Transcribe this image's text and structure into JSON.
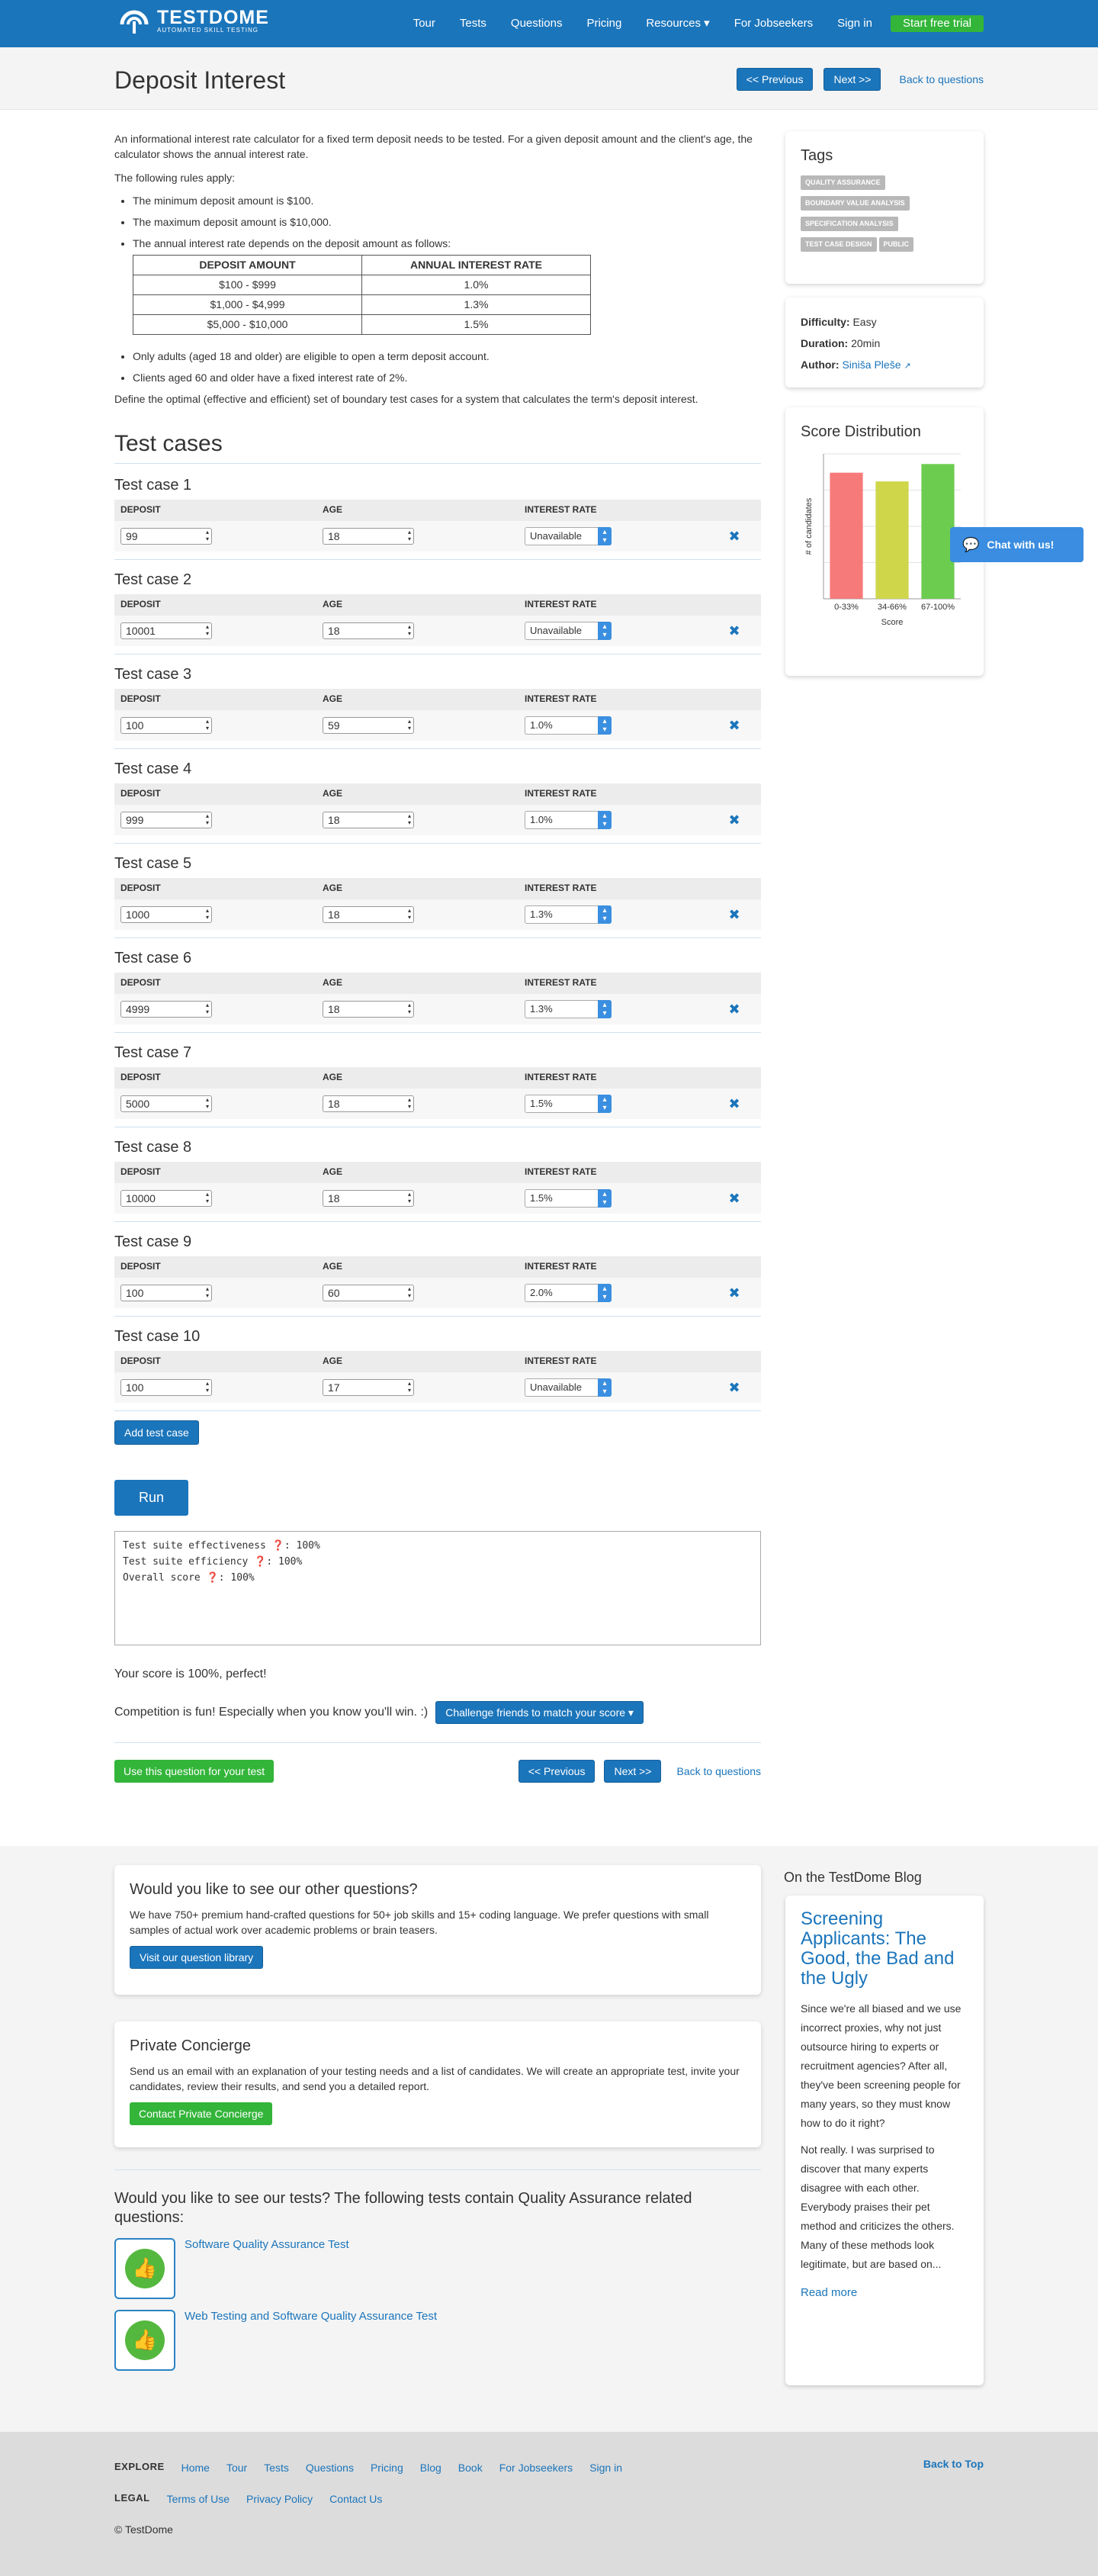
{
  "nav": {
    "logo": "TESTDOME",
    "logo_sub": "AUTOMATED SKILL TESTING",
    "links": [
      "Tour",
      "Tests",
      "Questions",
      "Pricing",
      "Resources ▾",
      "For Jobseekers",
      "Sign in"
    ],
    "trial": "Start free trial"
  },
  "header": {
    "title": "Deposit Interest",
    "prev": "<< Previous",
    "next": "Next >>",
    "back": "Back to questions"
  },
  "intro": {
    "p1": "An informational interest rate calculator for a fixed term deposit needs to be tested. For a given deposit amount and the client's age, the calculator shows the annual interest rate.",
    "p2": "The following rules apply:",
    "rules": [
      "The minimum deposit amount is $100.",
      "The maximum deposit amount is $10,000.",
      "The annual interest rate depends on the deposit amount as follows:"
    ],
    "table_head": [
      "DEPOSIT AMOUNT",
      "ANNUAL INTEREST RATE"
    ],
    "table_rows": [
      [
        "$100 - $999",
        "1.0%"
      ],
      [
        "$1,000 - $4,999",
        "1.3%"
      ],
      [
        "$5,000 - $10,000",
        "1.5%"
      ]
    ],
    "rules2": [
      "Only adults (aged 18 and older) are eligible to open a term deposit account.",
      "Clients aged 60 and older have a fixed interest rate of 2%."
    ],
    "p3": "Define the optimal (effective and efficient) set of boundary test cases for a system that calculates the term's deposit interest."
  },
  "tests": {
    "heading": "Test cases",
    "col_deposit": "DEPOSIT",
    "col_age": "AGE",
    "col_rate": "INTEREST RATE",
    "cases": [
      {
        "title": "Test case 1",
        "deposit": "99",
        "age": "18",
        "rate": "Unavailable"
      },
      {
        "title": "Test case 2",
        "deposit": "10001",
        "age": "18",
        "rate": "Unavailable"
      },
      {
        "title": "Test case 3",
        "deposit": "100",
        "age": "59",
        "rate": "1.0%"
      },
      {
        "title": "Test case 4",
        "deposit": "999",
        "age": "18",
        "rate": "1.0%"
      },
      {
        "title": "Test case 5",
        "deposit": "1000",
        "age": "18",
        "rate": "1.3%"
      },
      {
        "title": "Test case 6",
        "deposit": "4999",
        "age": "18",
        "rate": "1.3%"
      },
      {
        "title": "Test case 7",
        "deposit": "5000",
        "age": "18",
        "rate": "1.5%"
      },
      {
        "title": "Test case 8",
        "deposit": "10000",
        "age": "18",
        "rate": "1.5%"
      },
      {
        "title": "Test case 9",
        "deposit": "100",
        "age": "60",
        "rate": "2.0%"
      },
      {
        "title": "Test case 10",
        "deposit": "100",
        "age": "17",
        "rate": "Unavailable"
      }
    ],
    "add": "Add test case",
    "run": "Run"
  },
  "result": {
    "lines": [
      "Test suite effectiveness ❓: 100%",
      "Test suite efficiency ❓: 100%",
      "Overall score ❓: 100%"
    ],
    "score": "Your score is 100%, perfect!",
    "competition": "Competition is fun! Especially when you know you'll win. :)",
    "challenge": "Challenge friends to match your score ▾"
  },
  "bottomnav": {
    "use": "Use this question for your test",
    "prev": "<< Previous",
    "next": "Next >>",
    "back": "Back to questions"
  },
  "side": {
    "tags_title": "Tags",
    "tags": [
      "QUALITY ASSURANCE",
      "BOUNDARY VALUE ANALYSIS",
      "SPECIFICATION ANALYSIS",
      "TEST CASE DESIGN",
      "PUBLIC"
    ],
    "difficulty_label": "Difficulty:",
    "difficulty": "Easy",
    "duration_label": "Duration:",
    "duration": "20min",
    "author_label": "Author:",
    "author": "Siniša Pleše",
    "dist_title": "Score Distribution",
    "chat": "Chat with us!"
  },
  "chart_data": {
    "type": "bar",
    "title": "Score Distribution",
    "xlabel": "Score",
    "ylabel": "# of candidates",
    "categories": [
      "0-33%",
      "34-66%",
      "67-100%"
    ],
    "values": [
      0.87,
      0.81,
      0.93
    ],
    "colors": [
      "#f77a7a",
      "#cfd64a",
      "#6ccc4f"
    ],
    "grid": true
  },
  "library": {
    "title": "Would you like to see our other questions?",
    "text": "We have 750+ premium hand-crafted questions for 50+ job skills and 15+ coding language. We prefer questions with small samples of actual work over academic problems or brain teasers.",
    "button": "Visit our question library"
  },
  "concierge": {
    "title": "Private Concierge",
    "text": "Send us an email with an explanation of your testing needs and a list of candidates. We will create an appropriate test, invite your candidates, review their results, and send you a detailed report.",
    "button": "Contact Private Concierge"
  },
  "related": {
    "title": "Would you like to see our tests? The following tests contain Quality Assurance related questions:",
    "tests": [
      "Software Quality Assurance Test",
      "Web Testing and Software Quality Assurance Test"
    ]
  },
  "blog": {
    "heading": "On the TestDome Blog",
    "title": "Screening Applicants: The Good, the Bad and the Ugly",
    "p1": "Since we're all biased and we use incorrect proxies, why not just outsource hiring to experts or recruitment agencies? After all, they've been screening people for many years, so they must know how to do it right?",
    "p2": "Not really. I was surprised to discover that many experts disagree with each other. Everybody praises their pet method and criticizes the others. Many of these methods look legitimate, but are based on...",
    "more": "Read more"
  },
  "footer": {
    "explore": "EXPLORE",
    "explore_links": [
      "Home",
      "Tour",
      "Tests",
      "Questions",
      "Pricing",
      "Blog",
      "Book",
      "For Jobseekers",
      "Sign in"
    ],
    "legal": "LEGAL",
    "legal_links": [
      "Terms of Use",
      "Privacy Policy",
      "Contact Us"
    ],
    "copyright": "© TestDome",
    "top": "Back to Top"
  }
}
